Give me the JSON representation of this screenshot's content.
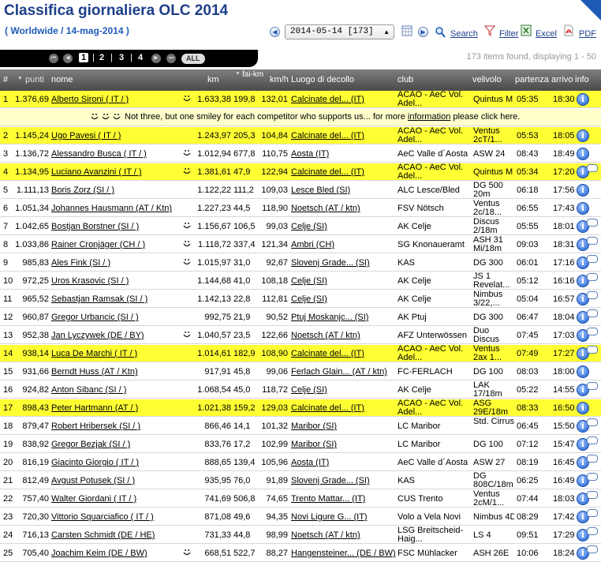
{
  "title": "Classifica giornaliera OLC 2014",
  "subtitle": "( Worldwide / 14-mag-2014 )",
  "date_select": "2014-05-14 [173]",
  "toolbar": {
    "search": "Search",
    "filter": "Filter",
    "excel": "Excel",
    "pdf": "PDF"
  },
  "pager": {
    "pages": [
      "1",
      "2",
      "3",
      "4"
    ],
    "current": "1",
    "all": "ALL"
  },
  "found": "173 items found, displaying 1 - 50",
  "columns": {
    "num": "#",
    "punti": "punti",
    "nome": "nome",
    "km": "km",
    "faikm": "fai-km",
    "kmh": "km/h",
    "luogo": "Luogo di decollo",
    "club": "club",
    "velivolo": "velivolo",
    "partenza": "partenza",
    "arrivo": "arrivo",
    "info": "info"
  },
  "notice": {
    "text_before": "Not three, but one smiley for each competitor who supports us... for more ",
    "link": "information",
    "text_after": " please click here."
  },
  "colors": {
    "highlight": "#ffff33",
    "title": "#1e3f8a",
    "notice": "#ffffcc"
  },
  "rows": [
    {
      "n": "1",
      "punti": "1.376,69",
      "nome": "Alberto Sironi ( IT / )",
      "smiley": true,
      "km": "1.633,38",
      "fai": "199,8",
      "kmh": "132,01",
      "luogo": "Calcinate del... (IT)",
      "club": "ACAO - AeC Vol. Adel...",
      "vel": "Quintus M",
      "p": "05:35",
      "a": "18:30",
      "hl": true,
      "bubble": false
    },
    {
      "n": "2",
      "punti": "1.145,24",
      "nome": "Ugo Pavesi ( IT / )",
      "smiley": false,
      "km": "1.243,97",
      "fai": "205,3",
      "kmh": "104,84",
      "luogo": "Calcinate del... (IT)",
      "club": "ACAO - AeC Vol. Adel...",
      "vel": "Ventus 2cT/1...",
      "p": "05:53",
      "a": "18:05",
      "hl": true,
      "bubble": false
    },
    {
      "n": "3",
      "punti": "1.136,72",
      "nome": "Alessandro Busca ( IT / )",
      "smiley": true,
      "km": "1.012,94",
      "fai": "677,8",
      "kmh": "110,75",
      "luogo": "Aosta (IT)",
      "club": "AeC Valle d´Aosta",
      "vel": "ASW 24",
      "p": "08:43",
      "a": "18:49",
      "hl": false,
      "bubble": false
    },
    {
      "n": "4",
      "punti": "1.134,95",
      "nome": "Luciano Avanzini ( IT / )",
      "smiley": true,
      "km": "1.381,61",
      "fai": "47,9",
      "kmh": "122,94",
      "luogo": "Calcinate del... (IT)",
      "club": "ACAO - AeC Vol. Adel...",
      "vel": "Quintus M",
      "p": "05:34",
      "a": "17:20",
      "hl": true,
      "bubble": true
    },
    {
      "n": "5",
      "punti": "1.111,13",
      "nome": "Boris Zorz (SI / )",
      "smiley": false,
      "km": "1.122,22",
      "fai": "111,2",
      "kmh": "109,03",
      "luogo": "Lesce Bled (SI)",
      "club": "ALC Lesce/Bled",
      "vel": "DG 500 20m",
      "p": "06:18",
      "a": "17:56",
      "hl": false,
      "bubble": false
    },
    {
      "n": "6",
      "punti": "1.051,34",
      "nome": "Johannes Hausmann (AT / Ktn)",
      "smiley": false,
      "km": "1.227,23",
      "fai": "44,5",
      "kmh": "118,90",
      "luogo": "Noetsch (AT / ktn)",
      "club": "FSV Nötsch",
      "vel": "Ventus 2c/18...",
      "p": "06:55",
      "a": "17:43",
      "hl": false,
      "bubble": false
    },
    {
      "n": "7",
      "punti": "1.042,65",
      "nome": "Bostjan Borstner (SI / )",
      "smiley": true,
      "km": "1.156,67",
      "fai": "106,5",
      "kmh": "99,03",
      "luogo": "Celje (SI)",
      "club": "AK Celje",
      "vel": "Discus 2/18m",
      "p": "05:55",
      "a": "18:01",
      "hl": false,
      "bubble": true
    },
    {
      "n": "8",
      "punti": "1.033,86",
      "nome": "Rainer Cronjäger (CH / )",
      "smiley": true,
      "km": "1.118,72",
      "fai": "337,4",
      "kmh": "121,34",
      "luogo": "Ambri (CH)",
      "club": "SG Knonaueramt",
      "vel": "ASH 31 Mi/18m",
      "p": "09:03",
      "a": "18:31",
      "hl": false,
      "bubble": true
    },
    {
      "n": "9",
      "punti": "985,83",
      "nome": "Ales Fink (SI / )",
      "smiley": true,
      "km": "1.015,97",
      "fai": "31,0",
      "kmh": "92,67",
      "luogo": "Slovenj Grade... (SI)",
      "club": "KAS",
      "vel": "DG 300",
      "p": "06:01",
      "a": "17:16",
      "hl": false,
      "bubble": true
    },
    {
      "n": "10",
      "punti": "972,25",
      "nome": "Uros Krasovic (SI / )",
      "smiley": false,
      "km": "1.144,68",
      "fai": "41,0",
      "kmh": "108,18",
      "luogo": "Celje (SI)",
      "club": "AK Celje",
      "vel": "JS 1 Revelat...",
      "p": "05:12",
      "a": "16:16",
      "hl": false,
      "bubble": true
    },
    {
      "n": "11",
      "punti": "965,52",
      "nome": "Sebastjan Ramsak (SI / )",
      "smiley": false,
      "km": "1.142,13",
      "fai": "22,8",
      "kmh": "112,81",
      "luogo": "Celje (SI)",
      "club": "AK Celje",
      "vel": "Nimbus 3/22,...",
      "p": "05:04",
      "a": "16:57",
      "hl": false,
      "bubble": true
    },
    {
      "n": "12",
      "punti": "960,87",
      "nome": "Gregor Urbancic (SI / )",
      "smiley": false,
      "km": "992,75",
      "fai": "21,9",
      "kmh": "90,52",
      "luogo": "Ptuj Moskanjc... (SI)",
      "club": "AK Ptuj",
      "vel": "DG 300",
      "p": "06:47",
      "a": "18:04",
      "hl": false,
      "bubble": true
    },
    {
      "n": "13",
      "punti": "952,38",
      "nome": "Jan Lyczywek (DE / BY)",
      "smiley": true,
      "km": "1.040,57",
      "fai": "23,5",
      "kmh": "122,66",
      "luogo": "Noetsch (AT / ktn)",
      "club": "AFZ Unterwössen",
      "vel": "Duo Discus",
      "p": "07:45",
      "a": "17:03",
      "hl": false,
      "bubble": true
    },
    {
      "n": "14",
      "punti": "938,14",
      "nome": "Luca De Marchi ( IT / )",
      "smiley": false,
      "km": "1.014,61",
      "fai": "182,9",
      "kmh": "108,90",
      "luogo": "Calcinate del... (IT)",
      "club": "ACAO - AeC Vol. Adel...",
      "vel": "Ventus 2ax 1...",
      "p": "07:49",
      "a": "17:27",
      "hl": true,
      "bubble": true
    },
    {
      "n": "15",
      "punti": "931,66",
      "nome": "Berndt Huss (AT / Ktn)",
      "smiley": false,
      "km": "917,91",
      "fai": "45,8",
      "kmh": "99,06",
      "luogo": "Ferlach Glain... (AT / ktn)",
      "club": "FC-FERLACH",
      "vel": "DG 100",
      "p": "08:03",
      "a": "18:00",
      "hl": false,
      "bubble": false
    },
    {
      "n": "16",
      "punti": "924,82",
      "nome": "Anton Sibanc (SI / )",
      "smiley": false,
      "km": "1.068,54",
      "fai": "45,0",
      "kmh": "118,72",
      "luogo": "Celje (SI)",
      "club": "AK Celje",
      "vel": "LAK 17/18m",
      "p": "05:22",
      "a": "14:55",
      "hl": false,
      "bubble": true
    },
    {
      "n": "17",
      "punti": "898,43",
      "nome": "Peter Hartmann (AT / )",
      "smiley": false,
      "km": "1.021,38",
      "fai": "159,2",
      "kmh": "129,03",
      "luogo": "Calcinate del... (IT)",
      "club": "ACAO - AeC Vol. Adel...",
      "vel": "ASG 29E/18m",
      "p": "08:33",
      "a": "16:50",
      "hl": true,
      "bubble": false
    },
    {
      "n": "18",
      "punti": "879,47",
      "nome": "Robert Hribersek (SI / )",
      "smiley": false,
      "km": "866,46",
      "fai": "14,1",
      "kmh": "101,32",
      "luogo": "Maribor (SI)",
      "club": "LC Maribor",
      "vel": "Std. Cirrus",
      "p": "06:45",
      "a": "15:50",
      "hl": false,
      "bubble": true
    },
    {
      "n": "19",
      "punti": "838,92",
      "nome": "Gregor Bezjak (SI / )",
      "smiley": false,
      "km": "833,76",
      "fai": "17,2",
      "kmh": "102,99",
      "luogo": "Maribor (SI)",
      "club": "LC Maribor",
      "vel": "DG 100",
      "p": "07:12",
      "a": "15:47",
      "hl": false,
      "bubble": true
    },
    {
      "n": "20",
      "punti": "816,19",
      "nome": "Giacinto Giorgio ( IT / )",
      "smiley": false,
      "km": "888,65",
      "fai": "139,4",
      "kmh": "105,96",
      "luogo": "Aosta (IT)",
      "club": "AeC Valle d´Aosta",
      "vel": "ASW 27",
      "p": "08:19",
      "a": "16:45",
      "hl": false,
      "bubble": true
    },
    {
      "n": "21",
      "punti": "812,49",
      "nome": "Avgust Potusek (SI / )",
      "smiley": false,
      "km": "935,95",
      "fai": "76,0",
      "kmh": "91,89",
      "luogo": "Slovenj Grade... (SI)",
      "club": "KAS",
      "vel": "DG 808C/18m",
      "p": "06:25",
      "a": "16:49",
      "hl": false,
      "bubble": true
    },
    {
      "n": "22",
      "punti": "757,40",
      "nome": "Walter Giordani ( IT / )",
      "smiley": false,
      "km": "741,69",
      "fai": "506,8",
      "kmh": "74,65",
      "luogo": "Trento Mattar... (IT)",
      "club": "CUS Trento",
      "vel": "Ventus 2cM/1...",
      "p": "07:44",
      "a": "18:03",
      "hl": false,
      "bubble": true
    },
    {
      "n": "23",
      "punti": "720,30",
      "nome": "Vittorio Squarciafico ( IT / )",
      "smiley": false,
      "km": "871,08",
      "fai": "49,6",
      "kmh": "94,35",
      "luogo": "Novi Ligure G... (IT)",
      "club": "Volo a Vela Novi",
      "vel": "Nimbus 4D",
      "p": "08:29",
      "a": "17:42",
      "hl": false,
      "bubble": true
    },
    {
      "n": "24",
      "punti": "716,13",
      "nome": "Carsten Schmidt (DE / HE)",
      "smiley": false,
      "km": "731,33",
      "fai": "44,8",
      "kmh": "98,99",
      "luogo": "Noetsch (AT / ktn)",
      "club": "LSG Breitscheid-Haig...",
      "vel": "LS 4",
      "p": "09:51",
      "a": "17:29",
      "hl": false,
      "bubble": true
    },
    {
      "n": "25",
      "punti": "705,40",
      "nome": "Joachim Keim (DE / BW)",
      "smiley": true,
      "km": "668,51",
      "fai": "522,7",
      "kmh": "88,27",
      "luogo": "Hangensteiner... (DE / BW)",
      "club": "FSC Mühlacker",
      "vel": "ASH 26E",
      "p": "10:06",
      "a": "18:24",
      "hl": false,
      "bubble": true
    }
  ]
}
